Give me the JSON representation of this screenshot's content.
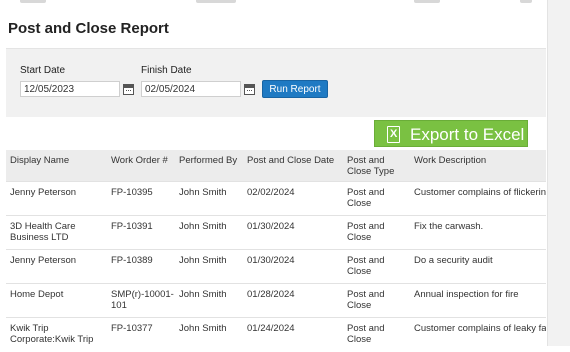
{
  "page": {
    "title": "Post and Close Report"
  },
  "filters": {
    "start_label": "Start Date",
    "start_value": "12/05/2023",
    "finish_label": "Finish Date",
    "finish_value": "02/05/2024",
    "run_label": "Run Report"
  },
  "export": {
    "label": "Export to Excel"
  },
  "table": {
    "headers": [
      "Display Name",
      "Work Order #",
      "Performed By",
      "Post and Close Date",
      "Post and Close Type",
      "Work Description"
    ],
    "rows": [
      [
        "Jenny Peterson",
        "FP-10395",
        "John Smith",
        "02/02/2024",
        "Post and Close",
        "Customer complains of flickering"
      ],
      [
        "3D Health Care Business LTD",
        "FP-10391",
        "John Smith",
        "01/30/2024",
        "Post and Close",
        "Fix the carwash."
      ],
      [
        "Jenny Peterson",
        "FP-10389",
        "John Smith",
        "01/30/2024",
        "Post and Close",
        "Do a security audit"
      ],
      [
        "Home Depot",
        "SMP(r)-10001-101",
        "John Smith",
        "01/28/2024",
        "Post and Close",
        "Annual inspection for fire"
      ],
      [
        "Kwik Trip Corporate:Kwik Trip",
        "FP-10377",
        "John Smith",
        "01/24/2024",
        "Post and Close",
        "Customer complains of leaky fau"
      ]
    ]
  },
  "colors": {
    "accent": "#1f7ac3",
    "excel": "#7ac142"
  }
}
